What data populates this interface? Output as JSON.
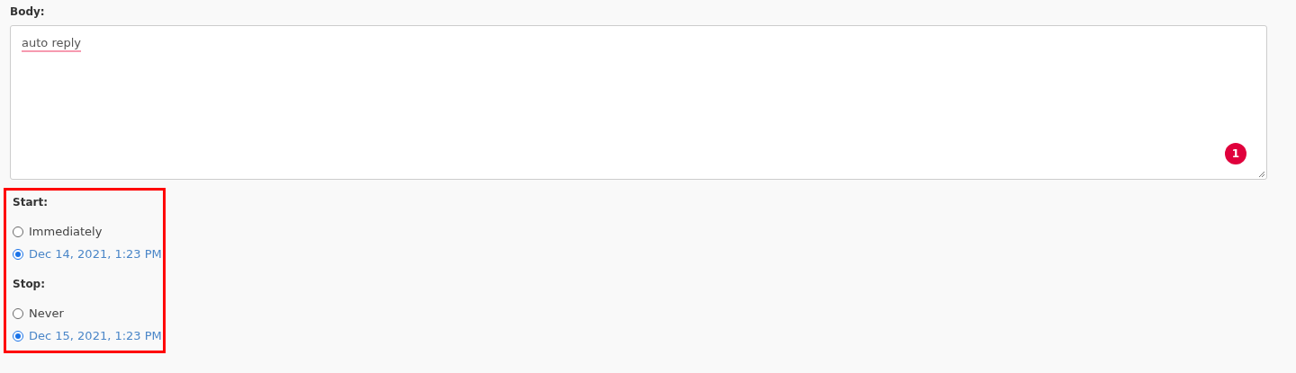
{
  "body": {
    "label": "Body:",
    "value": "auto reply",
    "badge": "1"
  },
  "schedule": {
    "highlighted": true,
    "groups": [
      {
        "label": "Start:",
        "options": [
          {
            "label": "Immediately",
            "selected": false
          },
          {
            "label": "Dec 14, 2021, 1:23 PM",
            "selected": true
          }
        ]
      },
      {
        "label": "Stop:",
        "options": [
          {
            "label": "Never",
            "selected": false
          },
          {
            "label": "Dec 15, 2021, 1:23 PM",
            "selected": true
          }
        ]
      }
    ]
  }
}
